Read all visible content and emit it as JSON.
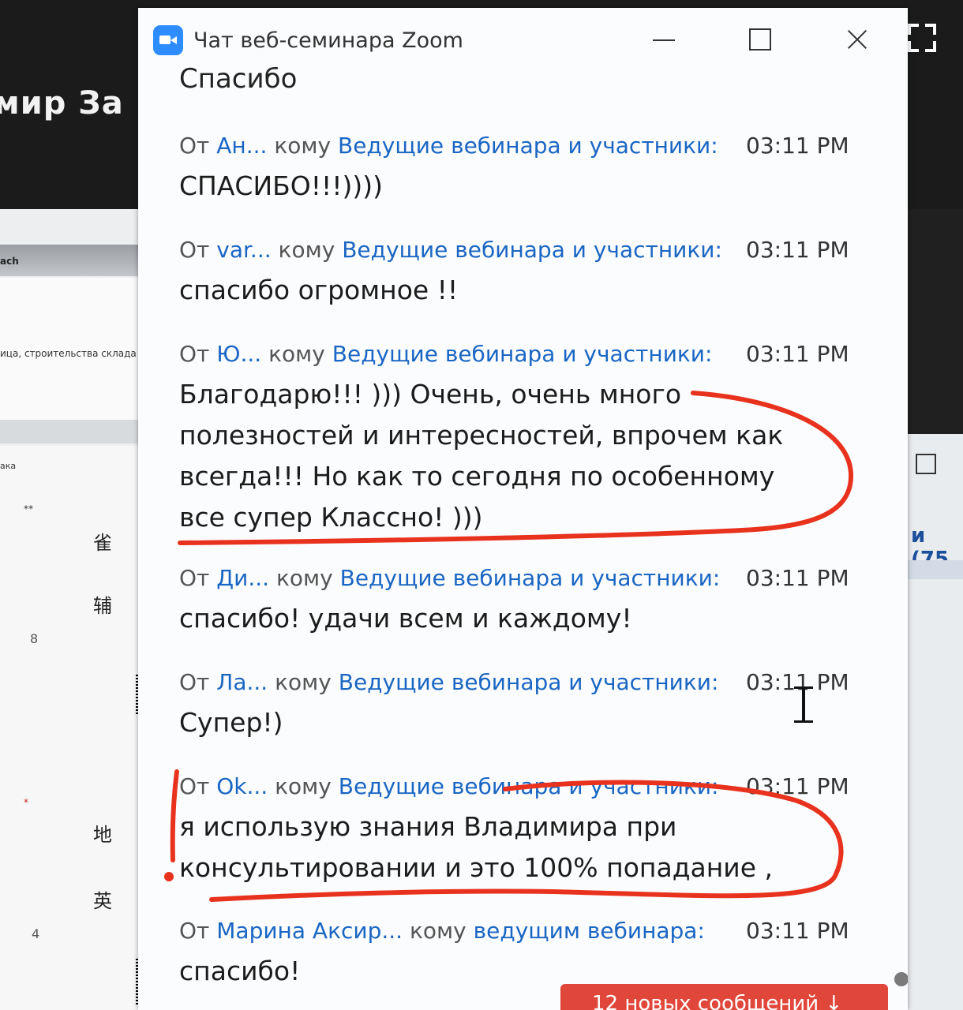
{
  "background": {
    "presenter_title": "мир За",
    "left_labels": [
      "ach",
      "ица, строительства склада",
      "ака"
    ],
    "left_cjk": [
      "雀",
      "辅",
      "地",
      "英"
    ],
    "left_numbers": [
      "8",
      "4"
    ],
    "left_marks": [
      "**",
      "*"
    ],
    "right_text": "и (75"
  },
  "window": {
    "title": "Чат веб-семинара Zoom",
    "icon": "zoom-logo-icon",
    "controls": [
      "minimize-icon",
      "maximize-icon",
      "close-icon"
    ]
  },
  "chat": {
    "clipped_top_text": "Спасибо",
    "messages": [
      {
        "from_prefix": "От",
        "sender": "Ан...",
        "to_prefix": "кому",
        "recipient": "Ведущие вебинара и участники:",
        "time": "03:11 PM",
        "text": "СПАСИБО!!!))))"
      },
      {
        "from_prefix": "От",
        "sender": "var...",
        "to_prefix": "кому",
        "recipient": "Ведущие вебинара и участники:",
        "time": "03:11 PM",
        "text": "спасибо огромное !!"
      },
      {
        "from_prefix": "От",
        "sender": "Ю...",
        "to_prefix": "кому",
        "recipient": "Ведущие вебинара и участники:",
        "time": "03:11 PM",
        "text": "Благодарю!!! ))) Очень, очень много полезностей и интересностей, впрочем как всегда!!! Но как то сегодня по особенному все супер Классно! )))"
      },
      {
        "from_prefix": "От",
        "sender": "Ди...",
        "to_prefix": "кому",
        "recipient": "Ведущие вебинара и участники:",
        "time": "03:11 PM",
        "text": "спасибо! удачи всем и каждому!"
      },
      {
        "from_prefix": "От",
        "sender": "Ла...",
        "to_prefix": "кому",
        "recipient": "Ведущие вебинара и участники:",
        "time": "03:11 PM",
        "text": "Супер!)"
      },
      {
        "from_prefix": "От",
        "sender": "Ok...",
        "to_prefix": "кому",
        "recipient": "Ведущие вебинара и участники:",
        "time": "03:11 PM",
        "text": "я использую знания Владимира при консультировании и это 100% попадание ,"
      },
      {
        "from_prefix": "От",
        "sender": "Марина Аксир...",
        "to_prefix": "кому",
        "recipient": "ведущим вебинара:",
        "time": "03:11 PM",
        "text": "спасибо!"
      }
    ],
    "new_messages_button": "12 новых сообщений ↓"
  },
  "colors": {
    "accent_blue": "#1a66c4",
    "zoom_blue": "#2d8cff",
    "annotation_red": "#e8321e",
    "new_messages_red": "#e0463a"
  }
}
